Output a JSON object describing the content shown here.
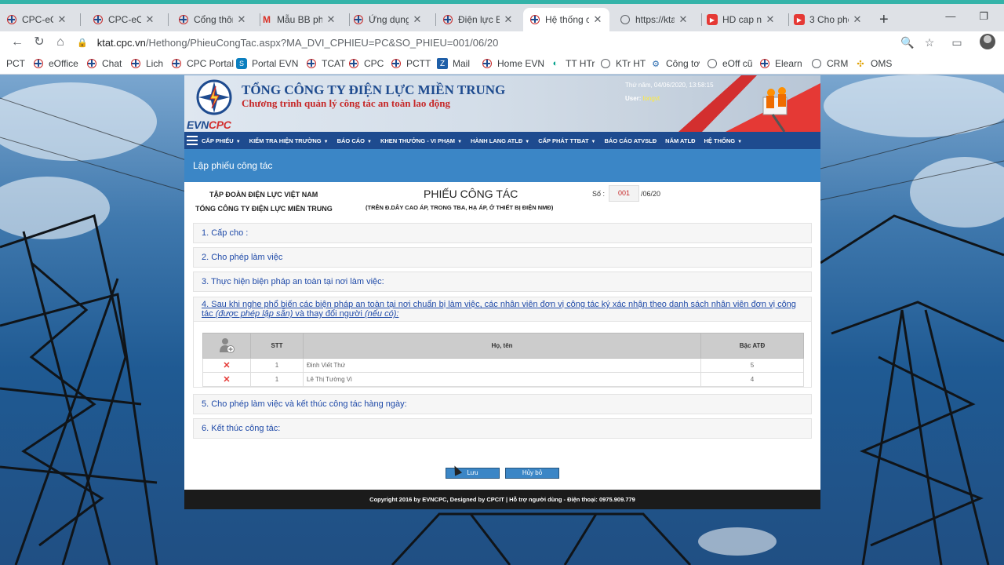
{
  "browser": {
    "tabs": [
      {
        "label": "CPC-eOffice",
        "icon": "evn-icon"
      },
      {
        "label": "CPC-eOffice",
        "icon": "evn-icon"
      },
      {
        "label": "Cổng thông",
        "icon": "evn-icon"
      },
      {
        "label": "Mẫu BB phổ",
        "icon": "gmail-icon"
      },
      {
        "label": "Ứng dụng n",
        "icon": "evn-icon"
      },
      {
        "label": "Điện lực Ea",
        "icon": "evn-icon"
      },
      {
        "label": "Hệ thống cả",
        "icon": "evn-icon",
        "active": true
      },
      {
        "label": "https://ktat.",
        "icon": "globe-icon"
      },
      {
        "label": "HD cap nhat",
        "icon": "youtube-icon"
      },
      {
        "label": "3 Cho phep",
        "icon": "youtube-icon"
      }
    ],
    "url_host": "ktat.cpc.vn",
    "url_path": "/Hethong/PhieuCongTac.aspx?MA_DVI_CPHIEU=PC&SO_PHIEU=001/06/20",
    "bookmarks": [
      {
        "label": "PCT",
        "icon": "evn-icon"
      },
      {
        "label": "eOffice",
        "icon": "evn-icon"
      },
      {
        "label": "Chat",
        "icon": "evn-icon"
      },
      {
        "label": "Lich",
        "icon": "evn-icon"
      },
      {
        "label": "CPC Portal",
        "icon": "evn-icon"
      },
      {
        "label": "Portal EVN",
        "icon": "sharepoint-icon"
      },
      {
        "label": "TCAT",
        "icon": "evn-icon"
      },
      {
        "label": "CPC",
        "icon": "evn-icon"
      },
      {
        "label": "PCTT",
        "icon": "evn-icon"
      },
      {
        "label": "Mail",
        "icon": "zimbra-icon"
      },
      {
        "label": "Home EVN",
        "icon": "evn-icon"
      },
      {
        "label": "TT HTr",
        "icon": "support-icon"
      },
      {
        "label": "KTr HT",
        "icon": "globe-icon"
      },
      {
        "label": "Công tơ",
        "icon": "meter-icon"
      },
      {
        "label": "eOff cũ",
        "icon": "globe-icon"
      },
      {
        "label": "Elearn",
        "icon": "evn-icon"
      },
      {
        "label": "CRM",
        "icon": "globe-icon"
      },
      {
        "label": "OMS",
        "icon": "oms-icon"
      }
    ]
  },
  "app": {
    "company_name": "TỔNG CÔNG TY ĐIỆN LỰC MIỀN TRUNG",
    "program_name": "Chương trình quản lý công tác an toàn lao động",
    "brand_evn": "EVN",
    "brand_cpc": "CPC",
    "datetime": "Thứ năm, 04/06/2020, 13:58:15",
    "user_label": "User:",
    "user_name": "longvt",
    "menu": [
      {
        "label": "CẤP PHIẾU",
        "dropdown": true
      },
      {
        "label": "KIỂM TRA HIỆN TRƯỜNG",
        "dropdown": true
      },
      {
        "label": "BÁO CÁO",
        "dropdown": true
      },
      {
        "label": "KHEN THƯỞNG - VI PHẠM",
        "dropdown": true
      },
      {
        "label": "HÀNH LANG ATLĐ",
        "dropdown": true
      },
      {
        "label": "CẤP PHÁT TTBAT",
        "dropdown": true
      },
      {
        "label": "BÁO CÁO ATVSLĐ",
        "dropdown": false
      },
      {
        "label": "NĂM ATLĐ",
        "dropdown": false
      },
      {
        "label": "HỆ THỐNG",
        "dropdown": true
      }
    ],
    "page_title": "Lập phiếu công tác",
    "colors": {
      "menu": "#1e4b8f",
      "titlebar": "#3b86c6",
      "section_text": "#1f4aa8",
      "number": "#c62828"
    }
  },
  "form": {
    "org_parent": "TẬP ĐOÀN ĐIỆN LỰC VIỆT NAM",
    "org_child": "TỔNG CÔNG TY ĐIỆN LỰC MIỀN TRUNG",
    "title": "PHIẾU CÔNG TÁC",
    "subtitle": "(TRÊN Đ.DÂY CAO ÁP, TRONG TBA, HẠ ÁP, Ở THIẾT BỊ ĐIỆN NMĐ)",
    "so_label": "Số :",
    "so_value": "001",
    "so_suffix": "/06/20",
    "sections": [
      "1. Cấp cho :",
      "2. Cho phép làm việc",
      "3. Thực hiện biện pháp an toàn tại nơi làm việc:",
      "5. Cho phép làm việc và kết thúc công tác hàng ngày:",
      "6. Kết thúc công tác:"
    ],
    "section4": {
      "text_a": "4. Sau khi nghe phổ biến các biện pháp an toàn tại nơi chuẩn bị làm việc, các nhân viên đơn vị công tác ký xác nhận theo danh sách nhân viên đơn vị công tác ",
      "text_b": "(được phép lập sẵn)",
      "text_c": " và thay đổi người ",
      "text_d": "(nếu có):"
    },
    "table": {
      "headers": [
        "STT",
        "Họ, tên",
        "Bậc ATĐ"
      ],
      "rows": [
        {
          "stt": "1",
          "name": "Đinh Viết Thứ",
          "bac": "5"
        },
        {
          "stt": "1",
          "name": "Lê Thị Tường Vi",
          "bac": "4"
        }
      ]
    },
    "save_label": "Lưu",
    "cancel_label": "Hủy bỏ"
  },
  "footer": "Copyright 2016 by EVNCPC, Designed by CPCIT | Hỗ trợ người dùng - Điện thoại: 0975.909.779"
}
